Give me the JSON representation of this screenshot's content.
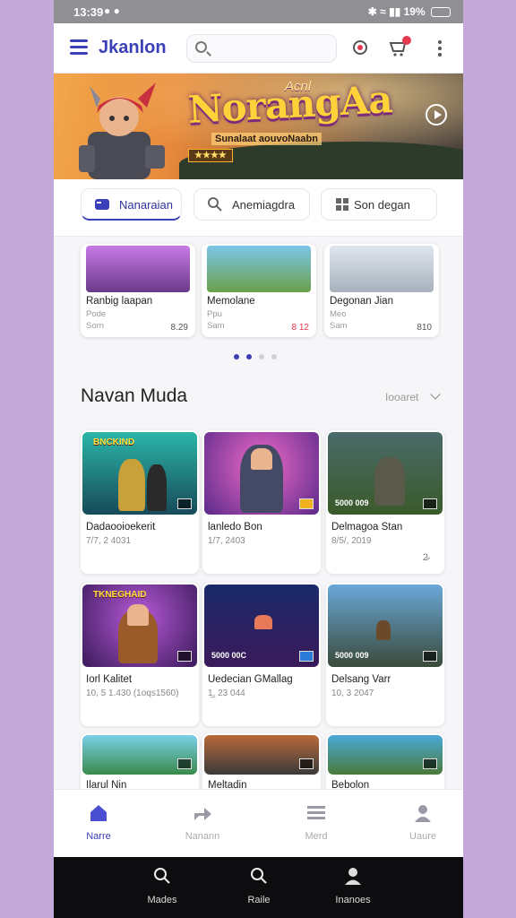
{
  "status_bar": {
    "time": "13:39",
    "battery": "19%"
  },
  "app": {
    "brand": "Jkanlon"
  },
  "search": {
    "placeholder": ""
  },
  "hero": {
    "badge": "Acnl",
    "title": "NorangAa",
    "subtitle": "Sunalaat aouvoNaabn"
  },
  "segments": [
    {
      "label": "Nanaraian",
      "icon": "gamepad-icon"
    },
    {
      "label": "Anemiagdra",
      "icon": "search-icon"
    },
    {
      "label": "Son degan",
      "icon": "grid-icon"
    }
  ],
  "carousel": [
    {
      "name": "Ranbig laapan",
      "meta": "Pode",
      "meta2": "Sorn",
      "price": "8.29"
    },
    {
      "name": "Memolane",
      "meta": "Ppu",
      "meta2": "Sam",
      "price": "8 12"
    },
    {
      "name": "Degonan Jian",
      "meta": "Meo",
      "meta2": "Sam",
      "price": "810"
    }
  ],
  "section": {
    "title": "Navan Muda",
    "sort_label": "Iooaret"
  },
  "grid": [
    {
      "title": "Dadaooioekerit",
      "date": "7/7, 2 4031",
      "extra": "",
      "hd": "BNCKIND",
      "stat": ""
    },
    {
      "title": "lanledo Bon",
      "date": "1/7, 2403",
      "extra": "",
      "hd": "",
      "stat": ""
    },
    {
      "title": "Delmagoa Stan",
      "date": "8/5/, 2019",
      "extra": "2̴",
      "hd": "",
      "stat": "5000 009"
    },
    {
      "title": "Iorl Kalitet",
      "date": "10, 5 1.430 (1oqs1560)",
      "extra": "",
      "hd": "TKNEGHAID",
      "stat": ""
    },
    {
      "title": "Uedecian GMallag",
      "date": "1̲, 23 044",
      "extra": "",
      "hd": "",
      "stat": "5000 00C"
    },
    {
      "title": "Delsang Varr",
      "date": "10, 3 2047",
      "extra": "",
      "hd": "",
      "stat": "5000 009"
    },
    {
      "title": "Ilarul Nin",
      "date": "",
      "extra": "",
      "hd": "",
      "stat": ""
    },
    {
      "title": "Meltadin",
      "date": "",
      "extra": "",
      "hd": "",
      "stat": ""
    },
    {
      "title": "Bebolon",
      "date": "",
      "extra": "",
      "hd": "",
      "stat": ""
    }
  ],
  "bottom_nav": [
    {
      "label": "Narre",
      "icon": "home-icon",
      "active": true
    },
    {
      "label": "Nanann",
      "icon": "share-icon",
      "active": false
    },
    {
      "label": "Merd",
      "icon": "list-icon",
      "active": false
    },
    {
      "label": "Uaure",
      "icon": "profile-icon",
      "active": false
    }
  ],
  "system_nav": [
    {
      "label": "Mades",
      "icon": "search-icon"
    },
    {
      "label": "Raile",
      "icon": "search-icon"
    },
    {
      "label": "Inanoes",
      "icon": "person-icon"
    }
  ],
  "colors": {
    "accent": "#3b3fb8",
    "background": "#f6f6f8",
    "sysnav": "#0d0d0f"
  }
}
